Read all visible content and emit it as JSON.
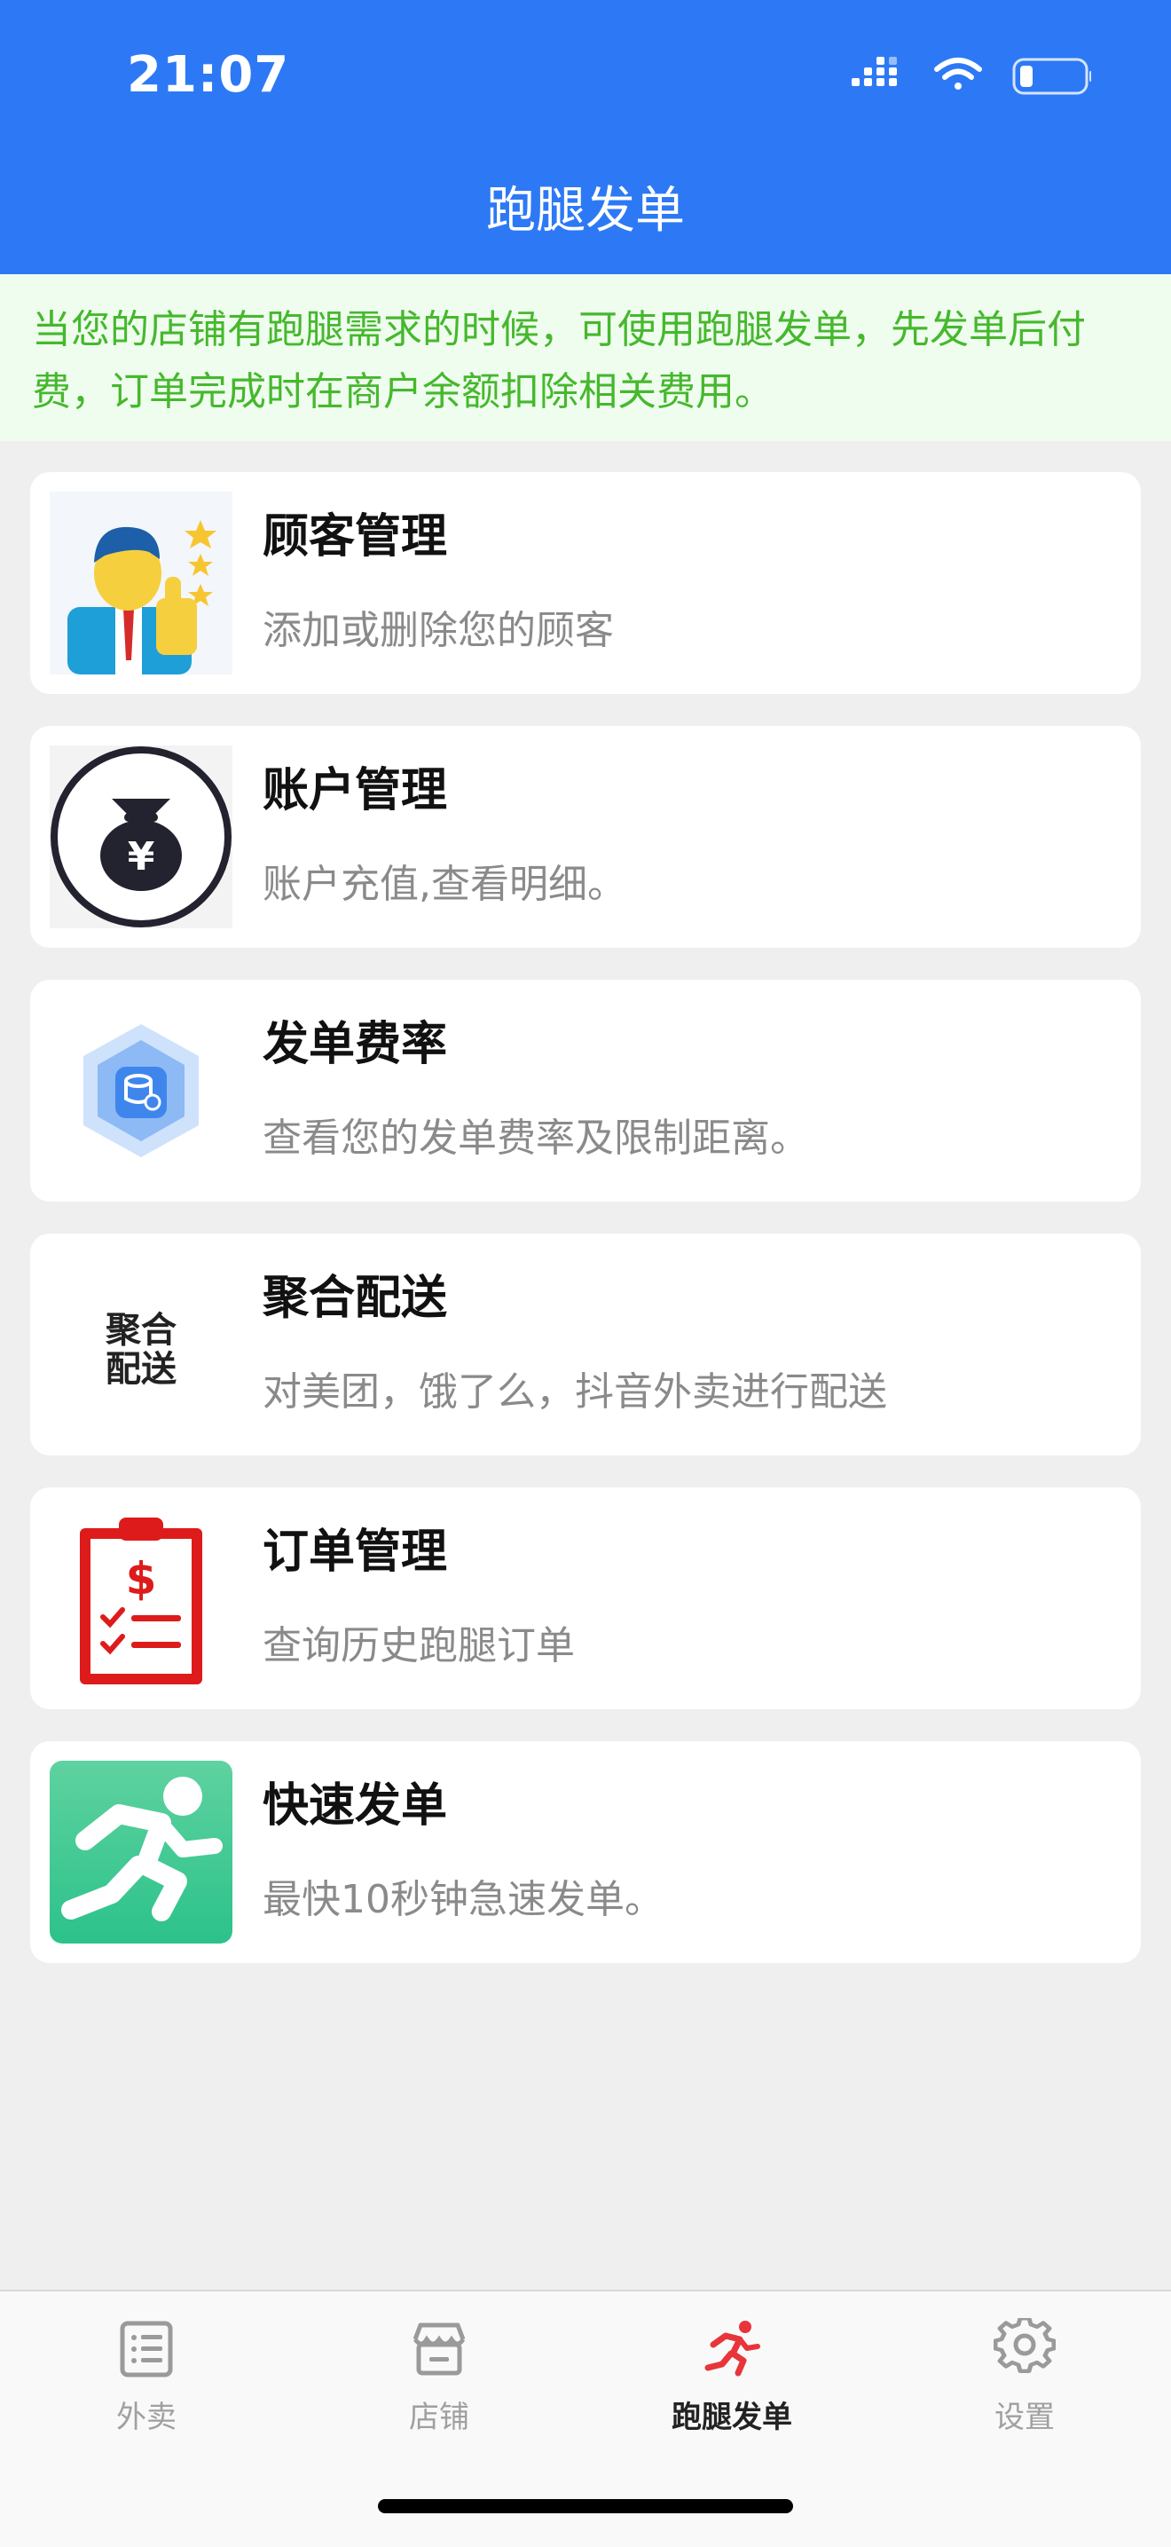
{
  "status": {
    "time": "21:07"
  },
  "nav": {
    "title": "跑腿发单"
  },
  "notice": {
    "text": "当您的店铺有跑腿需求的时候，可使用跑腿发单，先发单后付费，订单完成时在商户余额扣除相关费用。"
  },
  "cards": [
    {
      "title": "顾客管理",
      "desc": "添加或删除您的顾客",
      "icon": "customer-thumbs-up-icon"
    },
    {
      "title": "账户管理",
      "desc": "账户充值,查看明细。",
      "icon": "money-bag-icon"
    },
    {
      "title": "发单费率",
      "desc": "查看您的发单费率及限制距离。",
      "icon": "rate-hexagon-icon"
    },
    {
      "title": "聚合配送",
      "desc": "对美团，饿了么，抖音外卖进行配送",
      "icon": "aggregate-delivery-logo",
      "logo_text": [
        "聚合",
        "配送"
      ]
    },
    {
      "title": "订单管理",
      "desc": "查询历史跑腿订单",
      "icon": "clipboard-dollar-icon"
    },
    {
      "title": "快速发单",
      "desc": "最快10秒钟急速发单。",
      "icon": "running-man-icon"
    }
  ],
  "tabs": [
    {
      "label": "外卖",
      "icon": "list-icon",
      "active": false
    },
    {
      "label": "店铺",
      "icon": "store-icon",
      "active": false
    },
    {
      "label": "跑腿发单",
      "icon": "runner-icon",
      "active": true
    },
    {
      "label": "设置",
      "icon": "gear-icon",
      "active": false
    }
  ],
  "colors": {
    "header": "#2d79f5",
    "notice_text": "#46b82d",
    "active_tab_icon": "#e8353a"
  }
}
